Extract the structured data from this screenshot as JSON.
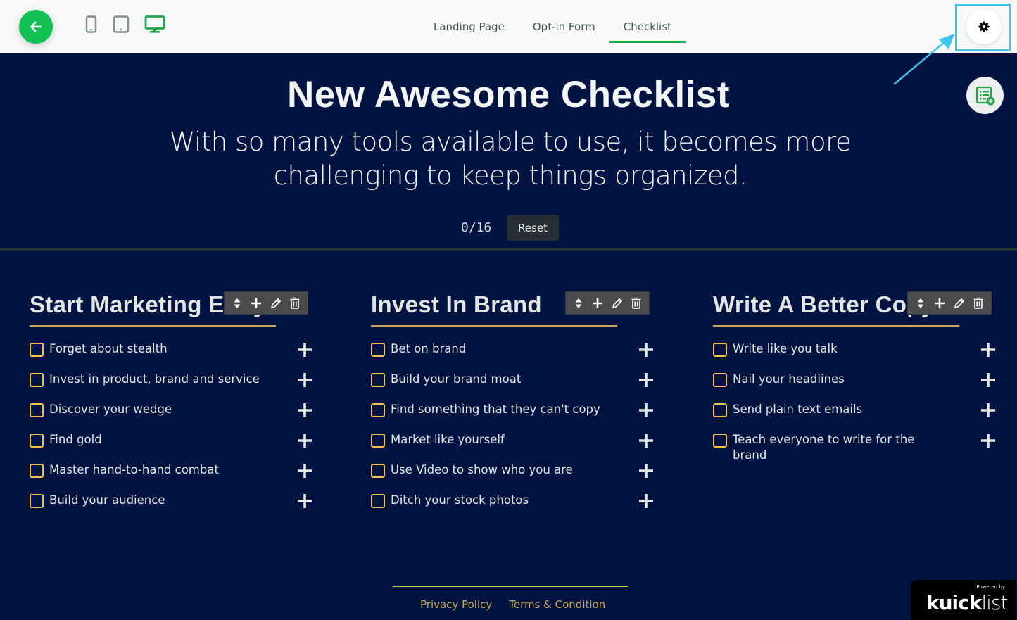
{
  "topbar": {
    "back_icon": "arrow-left-icon",
    "devices": [
      {
        "name": "mobile",
        "icon": "mobile-icon",
        "active": false
      },
      {
        "name": "tablet",
        "icon": "tablet-icon",
        "active": false
      },
      {
        "name": "desktop",
        "icon": "desktop-icon",
        "active": true
      }
    ],
    "tabs": [
      {
        "label": "Landing Page",
        "active": false
      },
      {
        "label": "Opt-in Form",
        "active": false
      },
      {
        "label": "Checklist",
        "active": true
      }
    ],
    "settings_icon": "gear-icon",
    "add_list_icon": "list-add-icon"
  },
  "colors": {
    "accent_green": "#12c154",
    "background": "#011340",
    "checkbox": "#f2c14b",
    "underline": "#c9a463",
    "highlight": "#3ec4ec"
  },
  "hero": {
    "title": "New Awesome Checklist",
    "subtitle": "With so many tools available to use, it becomes more challenging to keep things organized.",
    "progress": "0/16",
    "reset_label": "Reset"
  },
  "columns": [
    {
      "title": "Start Marketing Early",
      "items": [
        "Forget about stealth",
        "Invest in product, brand and service",
        "Discover your wedge",
        "Find gold",
        "Master hand-to-hand combat",
        "Build your audience"
      ]
    },
    {
      "title": "Invest In Brand",
      "items": [
        "Bet on brand",
        "Build your brand moat",
        "Find something that they can't copy",
        "Market like yourself",
        "Use Video to show who you are",
        "Ditch your stock photos"
      ]
    },
    {
      "title": "Write A Better Copy",
      "items": [
        "Write like you talk",
        "Nail your headlines",
        "Send plain text emails",
        "Teach everyone to write for the brand"
      ]
    }
  ],
  "footer": {
    "links": [
      "Privacy Policy",
      "Terms & Condition"
    ]
  },
  "badge": {
    "powered_by": "Powered by",
    "brand_bold": "kuick",
    "brand_light": "list"
  }
}
